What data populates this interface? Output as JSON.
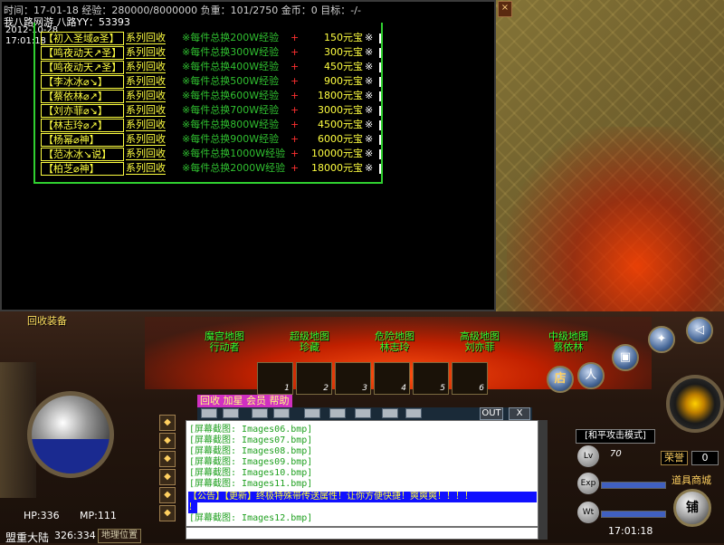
{
  "status_bar": {
    "text": "时间：17-01-18 经验：280000/8000000 负重：101/2750 金币：0 目标：-/-",
    "server": "我八路网游 八路YY：53393",
    "date": "2012-10-28",
    "time": "17:01:18"
  },
  "dialog": {
    "recycle_label": "系列回收",
    "rows": [
      {
        "name": "【初入圣域⌀圣】",
        "exp": "※每件总换200W经验",
        "plus": "+",
        "yuanbao": "150元宝",
        "tail": "※"
      },
      {
        "name": "【鸣夜动天↗圣】",
        "exp": "※每件总换300W经验",
        "plus": "+",
        "yuanbao": "300元宝",
        "tail": "※"
      },
      {
        "name": "【鸣夜动天↗圣】",
        "exp": "※每件总换400W经验",
        "plus": "+",
        "yuanbao": "450元宝",
        "tail": "※"
      },
      {
        "name": "【李冰冰⌀↘】",
        "exp": "※每件总换500W经验",
        "plus": "+",
        "yuanbao": "900元宝",
        "tail": "※"
      },
      {
        "name": "【蔡依林⌀↗】",
        "exp": "※每件总换600W经验",
        "plus": "+",
        "yuanbao": "1800元宝",
        "tail": "※"
      },
      {
        "name": "【刘亦菲⌀↘】",
        "exp": "※每件总换700W经验",
        "plus": "+",
        "yuanbao": "3000元宝",
        "tail": "※"
      },
      {
        "name": "【林志玲⌀↗】",
        "exp": "※每件总换800W经验",
        "plus": "+",
        "yuanbao": "4500元宝",
        "tail": "※"
      },
      {
        "name": "【杨幂⌀神】",
        "exp": "※每件总换900W经验",
        "plus": "+",
        "yuanbao": "6000元宝",
        "tail": "※"
      },
      {
        "name": "【范冰冰↘说】",
        "exp": "※每件总换1000W经验",
        "plus": "+",
        "yuanbao": "10000元宝",
        "tail": "※"
      },
      {
        "name": "【柏芝⌀神】",
        "exp": "※每件总换2000W经验",
        "plus": "+",
        "yuanbao": "18000元宝",
        "tail": "※"
      }
    ]
  },
  "hud": {
    "recycle_title": "回收装备",
    "map_buttons": [
      "魔宫地图\n行动者",
      "超级地图\n珍藏",
      "危险地图\n林志玲",
      "高级地图\n刘亦菲",
      "中级地图\n蔡依林"
    ],
    "shop_label": "店",
    "slots": [
      "1",
      "2",
      "3",
      "4",
      "5",
      "6"
    ],
    "hp": "HP:336",
    "mp": "MP:111",
    "map_name": "盟重大陆",
    "coords": "326:334",
    "geo_label": "地理位置"
  },
  "chat": {
    "menu": "回收 加星 会员 帮助",
    "out_label": "OUT",
    "close_label": "X",
    "lines_before": [
      "[屏幕截图: Images06.bmp]",
      "[屏幕截图: Images07.bmp]",
      "[屏幕截图: Images08.bmp]",
      "[屏幕截图: Images09.bmp]",
      "[屏幕截图: Images10.bmp]",
      "[屏幕截图: Images11.bmp]"
    ],
    "notice": "【公告】【更新】终极特殊带传送属性！让你方便快捷！爽爽爽！！！！",
    "notice_cont": "！",
    "line_after": "[屏幕截图: Images12.bmp]"
  },
  "panel": {
    "attack_mode": "[和平攻击模式]",
    "lv_label": "Lv",
    "lv_value": "70",
    "exp_label": "Exp",
    "wt_label": "Wt",
    "honor_label": "荣誉",
    "honor_value": "0",
    "shop_link": "道具商城",
    "clock": "17:01:18",
    "push_label": "铺"
  },
  "colors": {
    "dialog_border": "#30d030",
    "name_yellow": "#ffff40",
    "exp_green": "#30c030",
    "plus_red": "#ff3030",
    "chat_green": "#20a020",
    "notice_bg": "#1010ff",
    "notice_fg": "#ffff30",
    "menu_bg": "#d030c0"
  }
}
